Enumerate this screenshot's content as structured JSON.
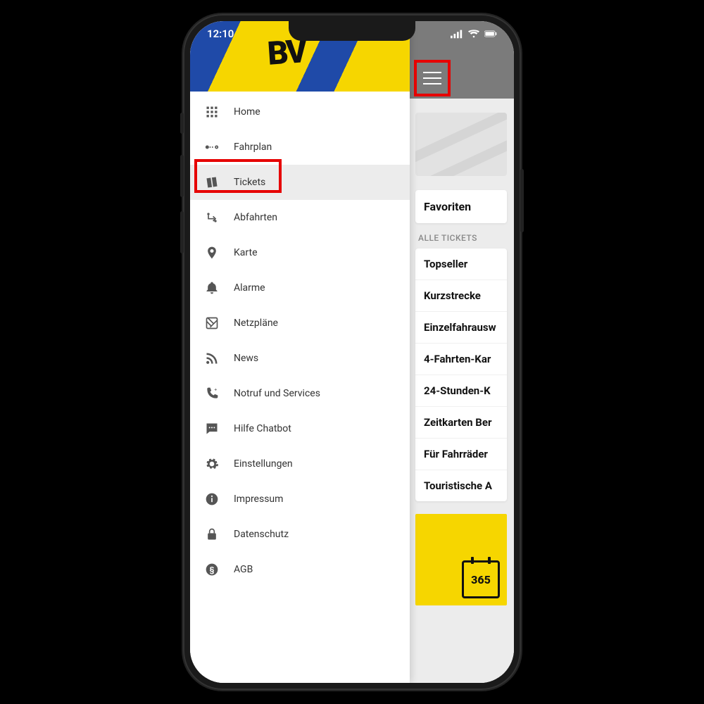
{
  "status": {
    "time": "12:10"
  },
  "drawer": {
    "items": [
      {
        "id": "home",
        "label": "Home",
        "icon": "grid-icon"
      },
      {
        "id": "fahrplan",
        "label": "Fahrplan",
        "icon": "route-icon"
      },
      {
        "id": "tickets",
        "label": "Tickets",
        "icon": "ticket-icon",
        "selected": true
      },
      {
        "id": "abfahrten",
        "label": "Abfahrten",
        "icon": "depart-icon"
      },
      {
        "id": "karte",
        "label": "Karte",
        "icon": "pin-icon"
      },
      {
        "id": "alarme",
        "label": "Alarme",
        "icon": "bell-icon"
      },
      {
        "id": "netzplaene",
        "label": "Netzpläne",
        "icon": "map-icon"
      },
      {
        "id": "news",
        "label": "News",
        "icon": "rss-icon"
      },
      {
        "id": "notruf",
        "label": "Notruf und Services",
        "icon": "phone-icon"
      },
      {
        "id": "chatbot",
        "label": "Hilfe Chatbot",
        "icon": "chat-icon"
      },
      {
        "id": "einstell",
        "label": "Einstellungen",
        "icon": "gear-icon"
      },
      {
        "id": "impressum",
        "label": "Impressum",
        "icon": "info-icon"
      },
      {
        "id": "datenschutz",
        "label": "Datenschutz",
        "icon": "lock-icon"
      },
      {
        "id": "agb",
        "label": "AGB",
        "icon": "section-icon"
      }
    ]
  },
  "content": {
    "favorites_label": "Favoriten",
    "section_label": "ALLE TICKETS",
    "tickets": [
      "Topseller",
      "Kurzstrecke",
      "Einzelfahrausw",
      "4-Fahrten-Kar",
      "24-Stunden-K",
      "Zeitkarten Ber",
      "Für Fahrräder",
      "Touristische A"
    ],
    "promo_badge": "365"
  },
  "highlights": {
    "tickets_nav": true,
    "hamburger": true
  },
  "colors": {
    "accent_yellow": "#f6d600",
    "highlight_red": "#e60000",
    "titlebar_gray": "#7b7b7b"
  }
}
